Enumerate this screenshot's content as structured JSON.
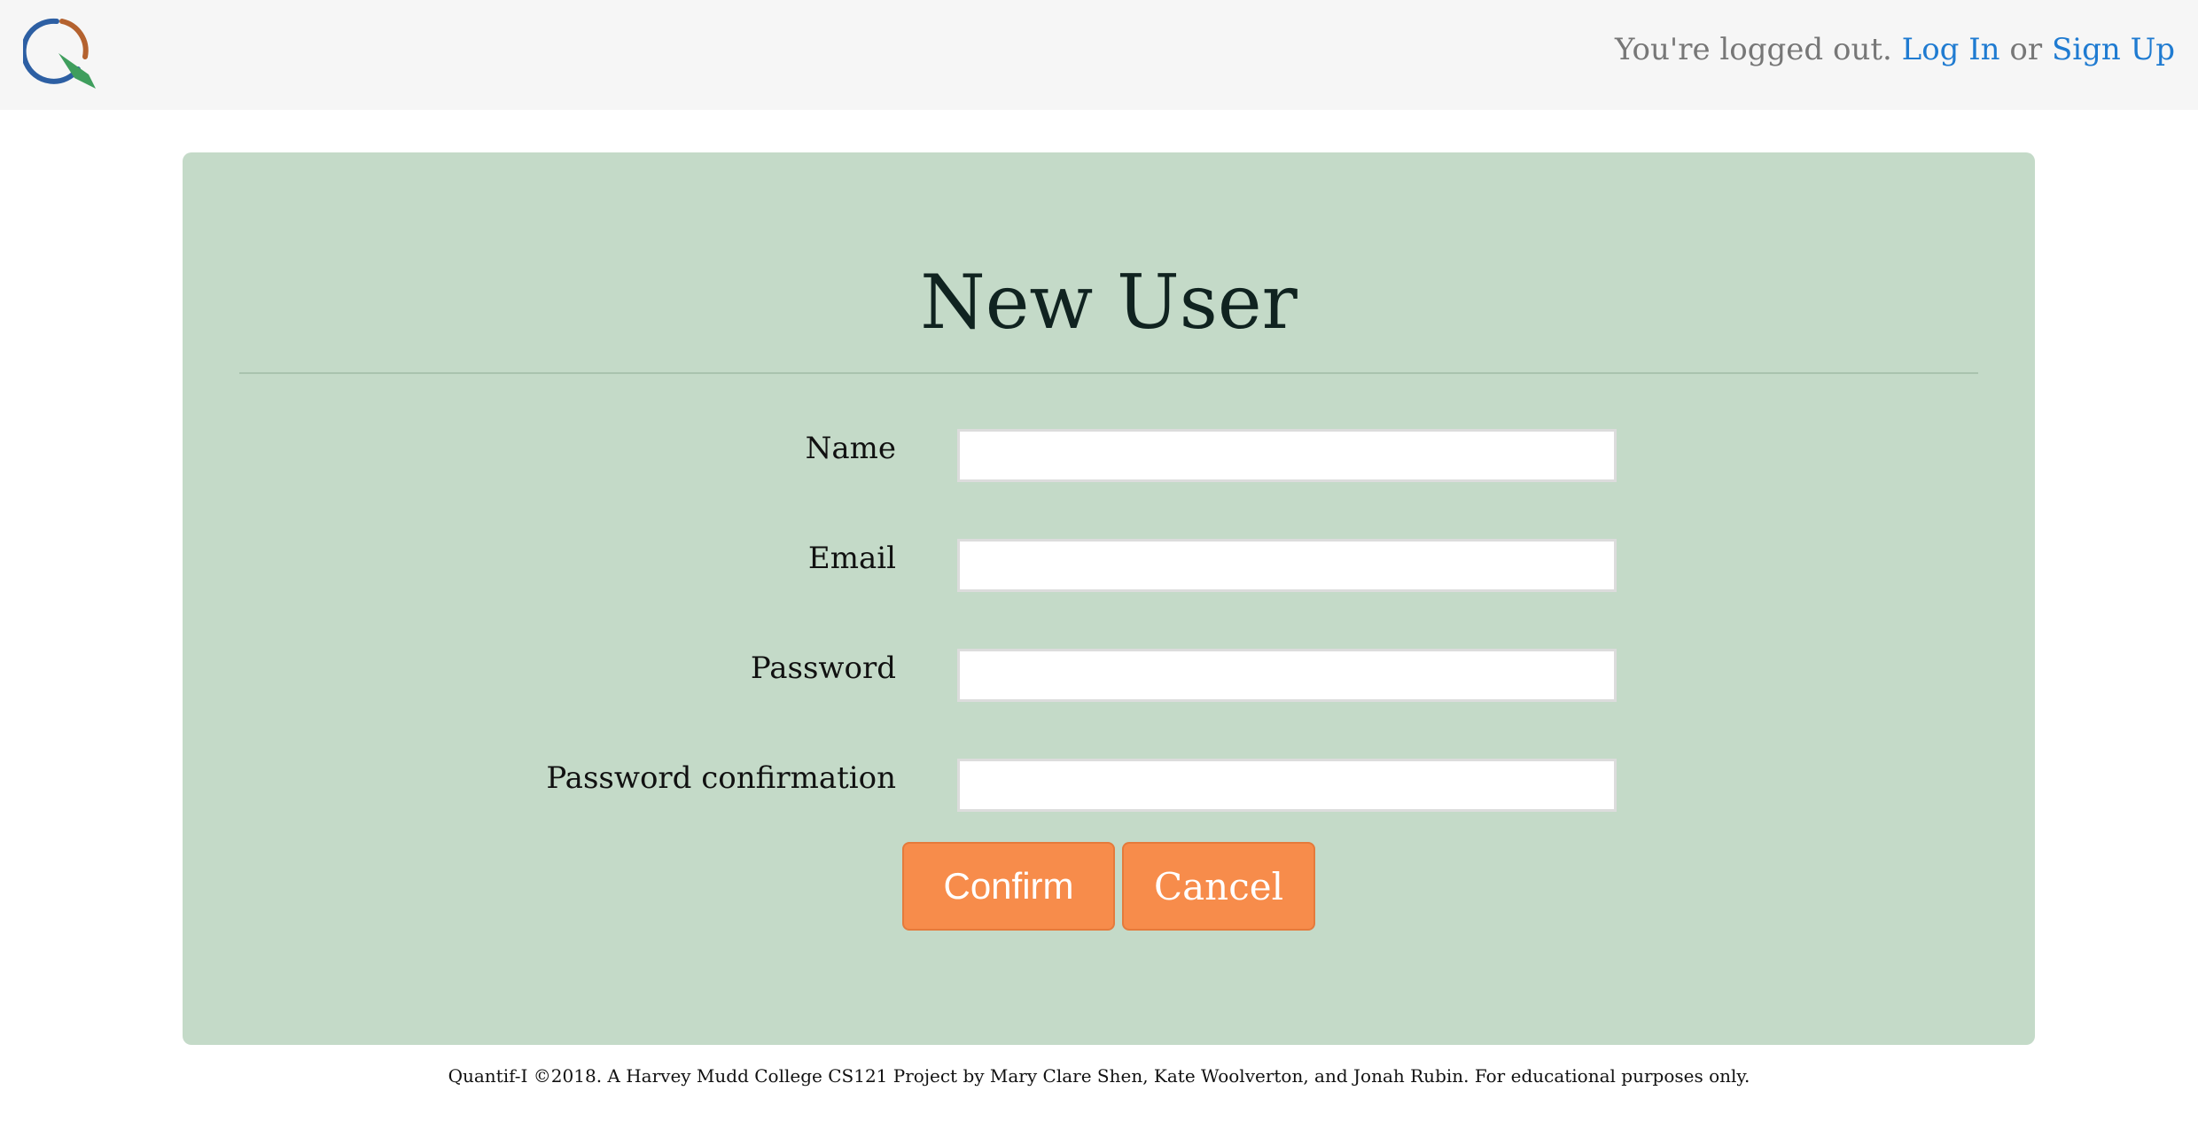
{
  "header": {
    "logo_icon": "quantif-i-q-logo-icon",
    "status_text": "You're logged out.",
    "login_link": "Log In",
    "or_text": "or",
    "signup_link": "Sign Up"
  },
  "form": {
    "title": "New User",
    "fields": [
      {
        "label": "Name",
        "value": ""
      },
      {
        "label": "Email",
        "value": ""
      },
      {
        "label": "Password",
        "value": ""
      },
      {
        "label": "Password confirmation",
        "value": ""
      }
    ],
    "confirm_label": "Confirm",
    "cancel_label": "Cancel"
  },
  "footer": {
    "text": "Quantif-I ©2018. A Harvey Mudd College CS121 Project by Mary Clare Shen, Kate Woolverton, and Jonah Rubin. For educational purposes only."
  },
  "colors": {
    "topbar_bg": "#f6f6f6",
    "card_bg": "#c4dac8",
    "link": "#1f7bd1",
    "button": "#f78c4b"
  }
}
